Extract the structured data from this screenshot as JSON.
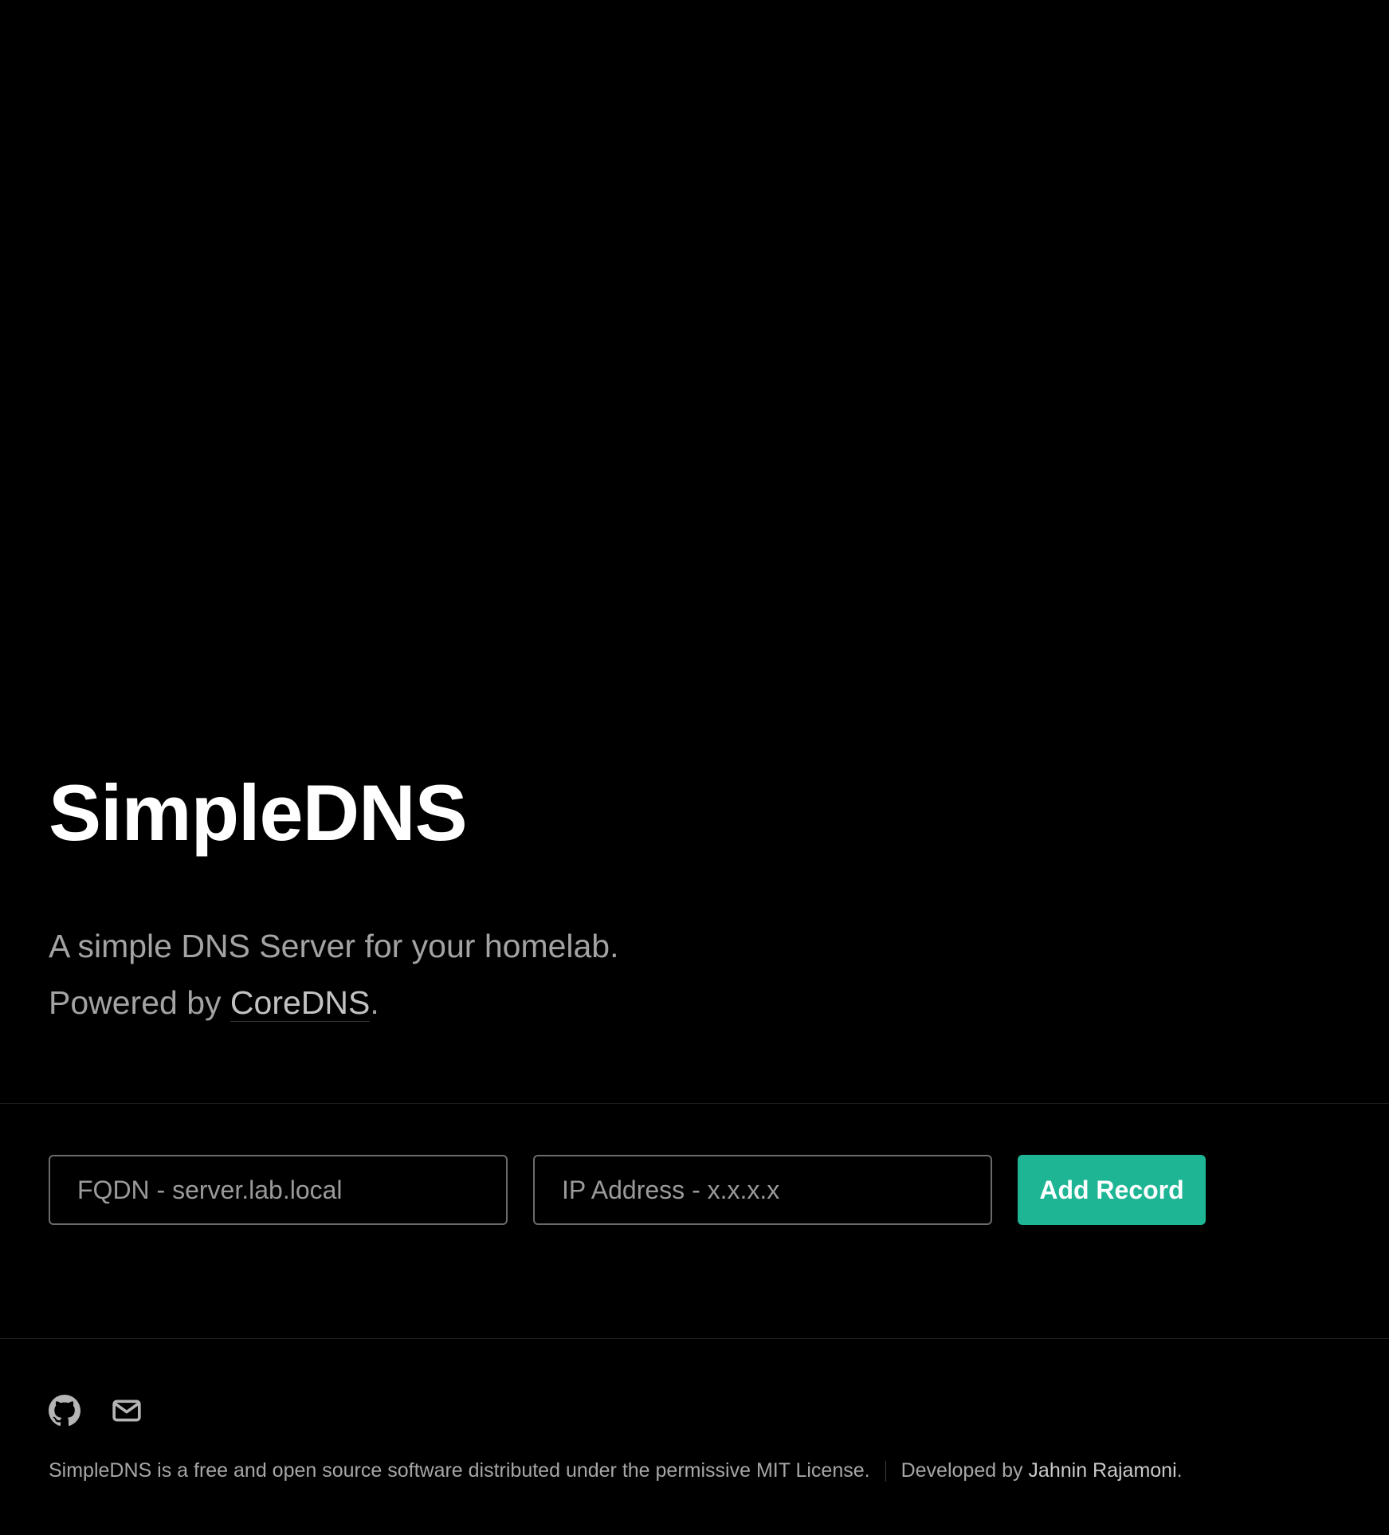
{
  "hero": {
    "title": "SimpleDNS",
    "subtitle_line1": "A simple DNS Server for your homelab.",
    "subtitle_line2_prefix": "Powered by ",
    "subtitle_link": "CoreDNS",
    "subtitle_line2_suffix": "."
  },
  "form": {
    "fqdn_placeholder": "FQDN - server.lab.local",
    "ip_placeholder": "IP Address - x.x.x.x",
    "fqdn_value": "",
    "ip_value": "",
    "submit_label": "Add Record"
  },
  "footer": {
    "icons": [
      "github-icon",
      "mail-icon"
    ],
    "license_text": "SimpleDNS is a free and open source software distributed under the permissive MIT License.",
    "developer_prefix": "Developed by ",
    "developer_name": "Jahnin Rajamoni",
    "developer_suffix": "."
  },
  "colors": {
    "background": "#000000",
    "accent": "#1db594",
    "text_primary": "#ffffff",
    "text_muted": "#a3a3a3",
    "border": "#6b6b6b"
  }
}
